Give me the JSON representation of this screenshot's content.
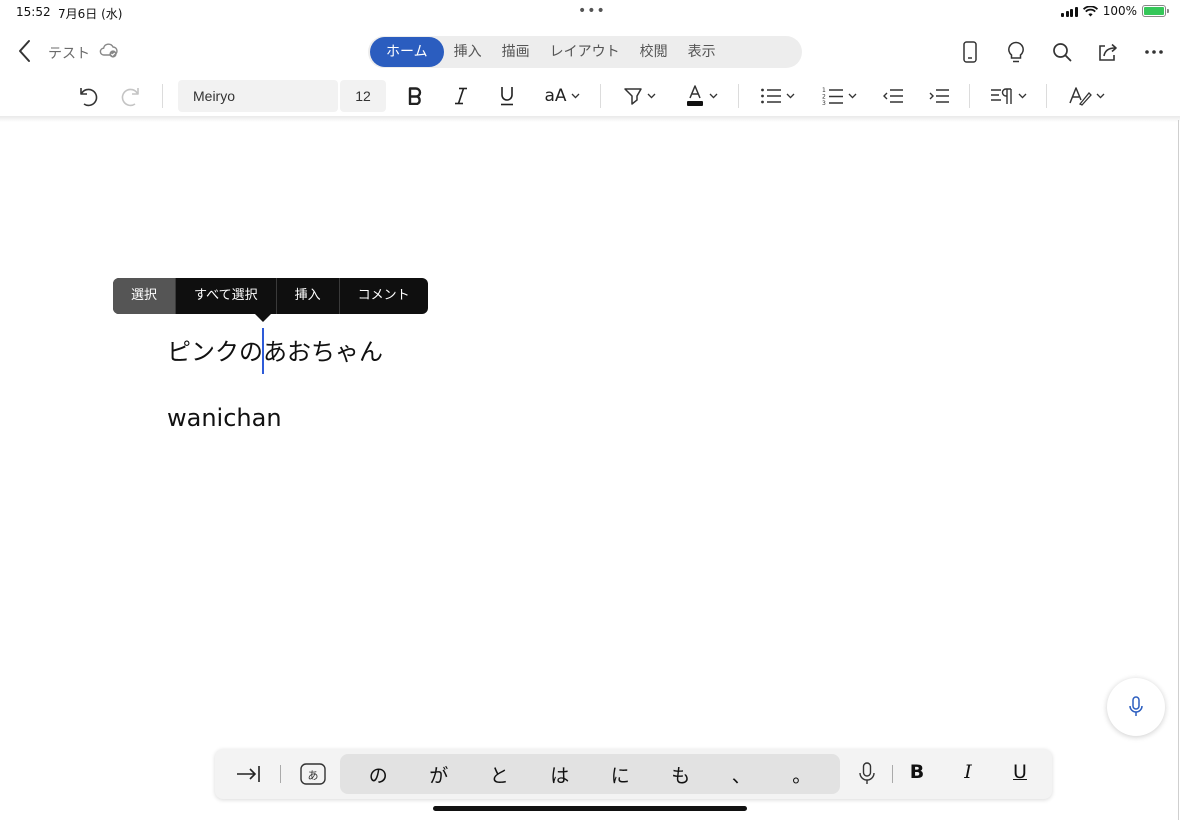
{
  "status": {
    "time": "15:52",
    "date": "7月6日 (水)",
    "battery": "100%",
    "multitask_dots": "•••"
  },
  "title": {
    "doc_name": "テスト"
  },
  "tabs": [
    {
      "label": "ホーム",
      "active": true
    },
    {
      "label": "挿入",
      "active": false
    },
    {
      "label": "描画",
      "active": false
    },
    {
      "label": "レイアウト",
      "active": false
    },
    {
      "label": "校閲",
      "active": false
    },
    {
      "label": "表示",
      "active": false
    }
  ],
  "ribbon": {
    "font_name": "Meiryo",
    "font_size": "12",
    "text_effects_label": "aA",
    "accent_color": "#2b5dbf",
    "font_color_swatch": "#111111"
  },
  "context_menu": {
    "items": [
      "選択",
      "すべて選択",
      "挿入",
      "コメント"
    ]
  },
  "document": {
    "paragraphs": [
      "ピンクのあおちゃん",
      "wanichan"
    ],
    "cursor_color": "#2e5bd8"
  },
  "keyboard": {
    "suggestions": [
      "の",
      "が",
      "と",
      "は",
      "に",
      "も",
      "、",
      "。"
    ],
    "bold": "B",
    "italic": "I",
    "underline": "U"
  }
}
